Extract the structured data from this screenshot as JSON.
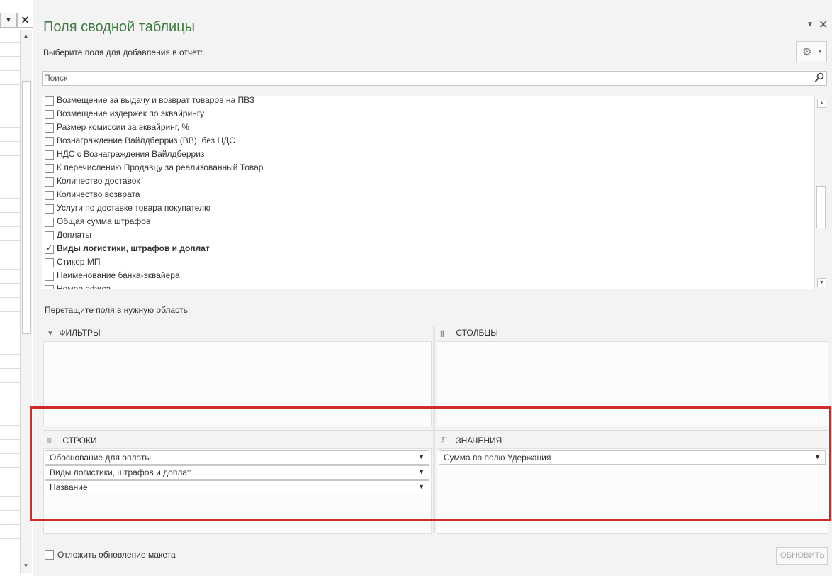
{
  "sheet": {
    "dropdown_glyph": "▼",
    "close_glyph": "✕",
    "scroll_up": "▲",
    "scroll_down": "▼"
  },
  "pane": {
    "title": "Поля сводной таблицы",
    "dropdown_glyph": "▼",
    "close_glyph": "✕",
    "subtitle": "Выберите поля для добавления в отчет:",
    "gear_icon": "⚙",
    "gear_caret": "▼"
  },
  "search": {
    "placeholder": "Поиск",
    "icon": "search-icon"
  },
  "fields": [
    {
      "label": "Возмещение за выдачу и возврат товаров на ПВЗ",
      "checked": false
    },
    {
      "label": "Возмещение издержек по эквайрингу",
      "checked": false
    },
    {
      "label": "Размер комиссии за эквайринг, %",
      "checked": false
    },
    {
      "label": "Вознаграждение Вайлдберриз (ВВ), без НДС",
      "checked": false
    },
    {
      "label": "НДС с Вознаграждения Вайлдберриз",
      "checked": false
    },
    {
      "label": "К перечислению Продавцу за реализованный Товар",
      "checked": false
    },
    {
      "label": "Количество доставок",
      "checked": false
    },
    {
      "label": "Количество возврата",
      "checked": false
    },
    {
      "label": "Услуги по доставке товара покупателю",
      "checked": false
    },
    {
      "label": "Общая сумма штрафов",
      "checked": false
    },
    {
      "label": "Доплаты",
      "checked": false
    },
    {
      "label": "Виды логистики, штрафов и доплат",
      "checked": true
    },
    {
      "label": "Стикер МП",
      "checked": false
    },
    {
      "label": "Наименование банка-эквайера",
      "checked": false
    },
    {
      "label": "Номер офиса",
      "checked": false
    }
  ],
  "field_scroll": {
    "up": "▲",
    "down": "▼"
  },
  "drag_label": "Перетащите поля в нужную область:",
  "areas": {
    "filters": {
      "title": "ФИЛЬТРЫ",
      "icon": "▼"
    },
    "columns": {
      "title": "СТОЛБЦЫ",
      "icon": "|||"
    },
    "rows": {
      "title": "СТРОКИ",
      "icon": "≡",
      "items": [
        "Обоснование для оплаты",
        "Виды логистики, штрафов и доплат",
        "Название"
      ]
    },
    "values": {
      "title": "ЗНАЧЕНИЯ",
      "icon": "Σ",
      "items": [
        "Сумма по полю Удержания"
      ]
    }
  },
  "chip_dropdown": "▼",
  "defer_label": "Отложить обновление макета",
  "update_button": "ОБНОВИТЬ",
  "colors": {
    "title_green": "#3d7a3f",
    "highlight_red": "#d22a2a"
  }
}
